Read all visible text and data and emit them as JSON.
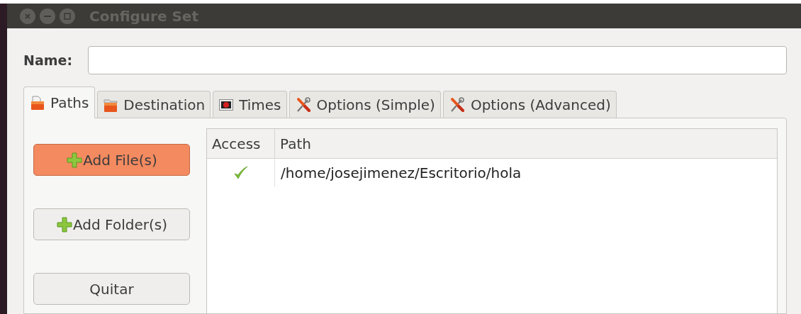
{
  "window": {
    "title": "Configure Set"
  },
  "name_field": {
    "label": "Name:"
  },
  "tabs": [
    {
      "label": "Paths",
      "kind": "file",
      "selected": true
    },
    {
      "label": "Destination",
      "kind": "folder",
      "selected": false
    },
    {
      "label": "Times",
      "kind": "stop",
      "selected": false
    },
    {
      "label": "Options (Simple)",
      "kind": "tools",
      "selected": false
    },
    {
      "label": "Options (Advanced)",
      "kind": "tools",
      "selected": false
    }
  ],
  "buttons": [
    {
      "label": "Add File(s)",
      "kind": "add",
      "focused": true
    },
    {
      "label": "Add Folder(s)",
      "kind": "add",
      "focused": false
    },
    {
      "label": "Quitar",
      "kind": "plain",
      "focused": false
    }
  ],
  "table": {
    "columns": [
      "Access",
      "Path"
    ],
    "rows": [
      {
        "access": true,
        "path": "/home/josejimenez/Escritorio/hola"
      }
    ]
  }
}
